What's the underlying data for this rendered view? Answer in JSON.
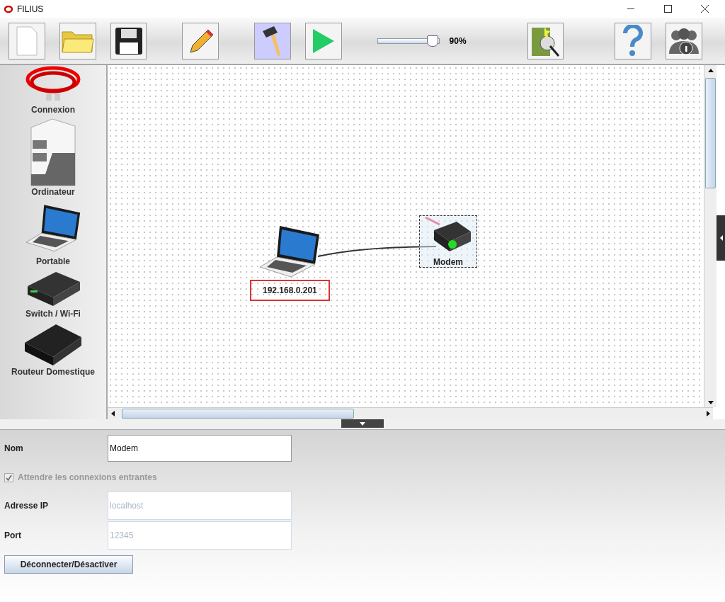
{
  "window": {
    "title": "FILIUS"
  },
  "toolbar": {
    "buttons": [
      {
        "kind": "new",
        "selected": false
      },
      {
        "kind": "open",
        "selected": false
      },
      {
        "kind": "save",
        "selected": false
      },
      {
        "kind": "pencil",
        "selected": false
      },
      {
        "kind": "hammer",
        "selected": true
      },
      {
        "kind": "play",
        "selected": false
      }
    ],
    "zoom": {
      "level": 0.9,
      "reading": "90%"
    },
    "right_buttons": [
      {
        "kind": "wizard"
      },
      {
        "kind": "help"
      },
      {
        "kind": "about"
      }
    ]
  },
  "palette": [
    {
      "kind": "cable",
      "label": "Connexion"
    },
    {
      "kind": "computer",
      "label": "Ordinateur"
    },
    {
      "kind": "laptop",
      "label": "Portable"
    },
    {
      "kind": "switch",
      "label": "Switch / Wi-Fi"
    },
    {
      "kind": "router",
      "label": "Routeur Domestique"
    }
  ],
  "canvas": {
    "nodes": [
      {
        "kind": "laptop",
        "label": "192.168.0.201",
        "selected": false
      },
      {
        "kind": "modem",
        "label": "Modem",
        "selected": true
      }
    ]
  },
  "properties": {
    "name": {
      "label": "Nom",
      "value": "Modem"
    },
    "listen": {
      "label": "Attendre les connexions entrantes",
      "checked": true,
      "disabled": true
    },
    "ip": {
      "label": "Adresse IP",
      "value": "localhost",
      "disabled": true
    },
    "port": {
      "label": "Port",
      "value": "12345",
      "disabled": true
    },
    "button": "Déconnecter/Désactiver"
  }
}
